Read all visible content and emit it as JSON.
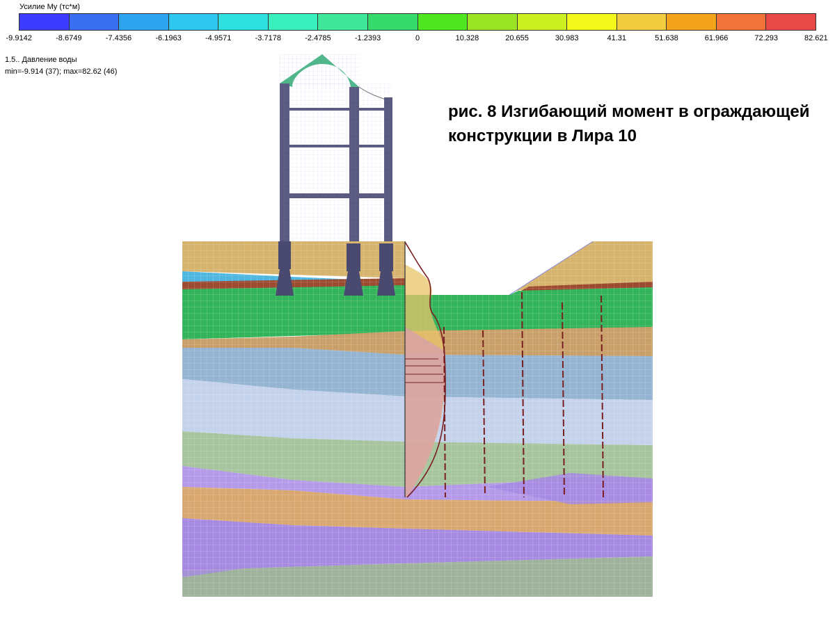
{
  "legend": {
    "title": "Усилие My (тс*м)",
    "colors": [
      "#3c3cff",
      "#3a6ff2",
      "#2ea3ef",
      "#2ec7ef",
      "#2ee0df",
      "#38efbd",
      "#3ee79a",
      "#36d96c",
      "#4fe620",
      "#9be425",
      "#cbef20",
      "#f3f71a",
      "#f2cd40",
      "#f4a41a",
      "#f2733a",
      "#e84848"
    ],
    "ticks": [
      "-9.9142",
      "-8.6749",
      "-7.4356",
      "-6.1963",
      "-4.9571",
      "-3.7178",
      "-2.4785",
      "-1.2393",
      "0",
      "10.328",
      "20.655",
      "30.983",
      "41.31",
      "51.638",
      "61.966",
      "72.293",
      "82.621"
    ]
  },
  "case": {
    "name": "1.5.. Давление воды",
    "minmax": "min=-9.914 (37); max=82.62 (46)"
  },
  "caption": "рис. 8 Изгибающий момент в ограждающей конструкции в Лира 10",
  "model": {
    "soil_colors": {
      "fill": "#d6b46e",
      "water": "#4fb6e0",
      "clay_band": "#9c4a30",
      "green": "#33b35a",
      "loam": "#c9a06a",
      "blue_gray": "#94b4d2",
      "light_blue": "#c4d2ec",
      "green_gray": "#a6c49e",
      "violet": "#b49ae8",
      "orange": "#d9a870",
      "deep_violet": "#a68ae2",
      "gray_green": "#9eb29c"
    },
    "frame_color": "#5a5a80",
    "arch_color": "#4fb889",
    "mesh_color": "#8888dd",
    "diagram_color": "#7a1f1f"
  }
}
